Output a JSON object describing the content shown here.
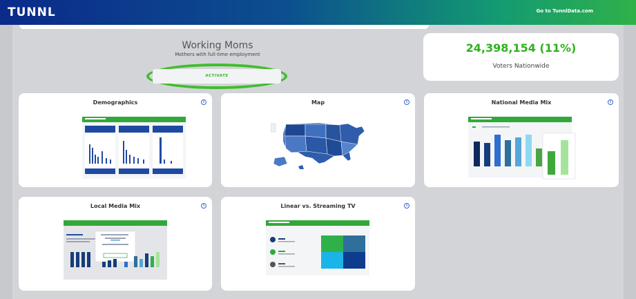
{
  "header": {
    "logo_text": "TUNNL",
    "goto_link": "Go to TunnlData.com"
  },
  "segment": {
    "title": "Working Moms",
    "subtitle": "Mothers with full-time employment",
    "activate_label": "ACTIVATE"
  },
  "stat": {
    "value": "24,398,154 (11%)",
    "label": "Voters Nationwide"
  },
  "cards": {
    "demographics": {
      "title": "Demographics",
      "info": "i"
    },
    "map": {
      "title": "Map",
      "info": "i"
    },
    "national_media_mix": {
      "title": "National Media Mix",
      "info": "i"
    },
    "local_media_mix": {
      "title": "Local Media Mix",
      "info": "i"
    },
    "linear_vs_streaming": {
      "title": "Linear vs. Streaming TV",
      "info": "i"
    }
  },
  "colors": {
    "accent_green": "#2fb11d",
    "brand_blue": "#0b2a8a",
    "info_blue": "#3a66c4"
  }
}
